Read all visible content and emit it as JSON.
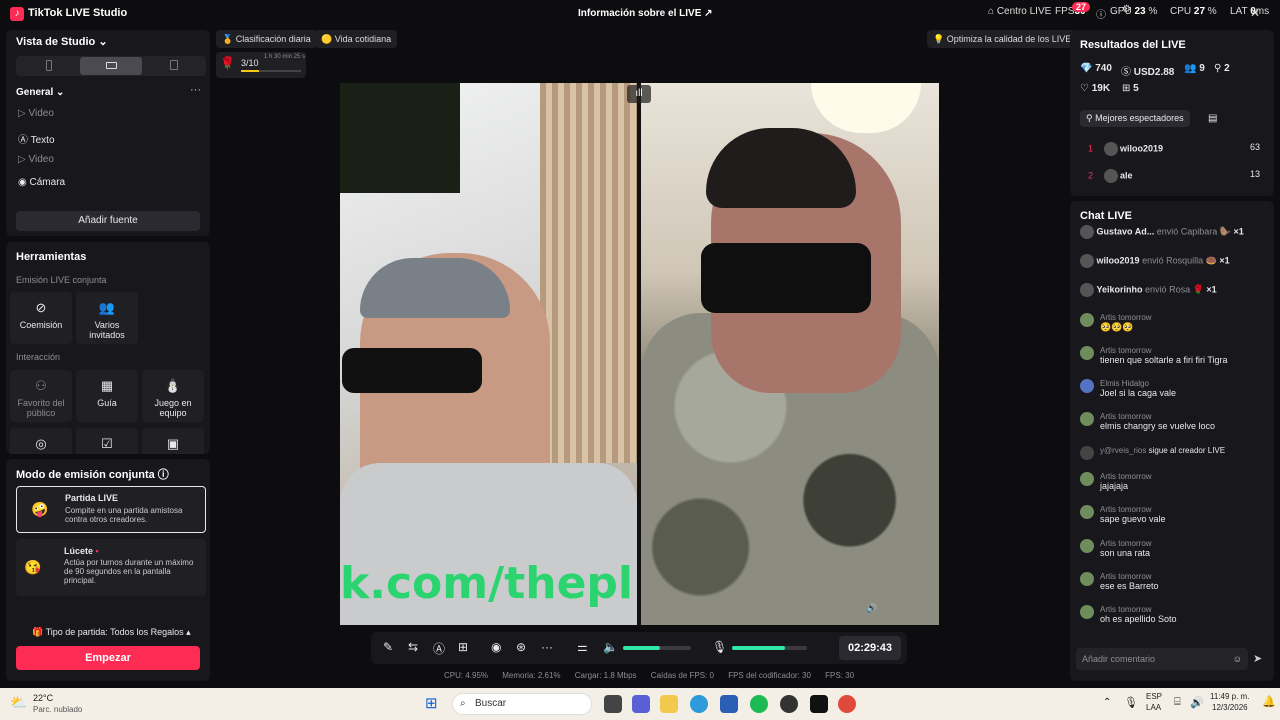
{
  "titlebar": {
    "app_title": "TikTok LIVE Studio",
    "live_info": "Información sobre el LIVE",
    "centro_live": "Centro LIVE",
    "fps_label": "FPS",
    "fps_value": "30",
    "fps_badge": "27",
    "gpu_label": "GPU",
    "gpu_value": "23",
    "cpu_label": "CPU",
    "cpu_value": "27",
    "lat_label": "LAT",
    "lat_value": "0"
  },
  "studio": {
    "view_label": "Vista de Studio",
    "general_label": "General",
    "sources": [
      "Video",
      "Texto",
      "Video",
      "Cámara"
    ],
    "add_source": "Añadir fuente"
  },
  "tools": {
    "title": "Herramientas",
    "joint_label": "Emisión LIVE conjunta",
    "joint_items": [
      "Coemisión",
      "Varios invitados"
    ],
    "interaction_label": "Interacción",
    "interaction_items": [
      "Favorito del público",
      "Guía",
      "Juego en equipo"
    ]
  },
  "joint_mode": {
    "title": "Modo de emisión conjunta",
    "modes": [
      {
        "name": "Partida LIVE",
        "desc": "Compite en una partida amistosa contra otros creadores."
      },
      {
        "name": "Lúcete",
        "desc": "Actúa por turnos durante un máximo de 90 segundos en la pantalla principal."
      }
    ],
    "match_type": "Tipo de partida: Todos los Regalos",
    "start": "Empezar"
  },
  "top_chips": {
    "daily_rank": "Clasificación diaria",
    "daily_life": "Vida cotidiana",
    "optimize": "Optimiza la calidad de los LIVE",
    "match_count": "3/10",
    "match_time": "1 h 30 min 25 s"
  },
  "video": {
    "banner_text": "k.com/thepl"
  },
  "controls": {
    "timer": "02:29:43",
    "volume_fraction": 0.55,
    "mic_fraction": 0.7
  },
  "perf": {
    "cpu": "CPU:  4.95%",
    "memory": "Memoria:  2.61%",
    "load": "Cargar:  1.8 Mbps",
    "fps_drops": "Caídas de FPS:  0",
    "encoder_fps": "FPS del codificador:  30",
    "fps": "FPS:  30"
  },
  "results": {
    "title": "Resultados del LIVE",
    "diamonds": "740",
    "usd": "USD2.88",
    "viewers": "9",
    "new_followers": "2",
    "likes": "19K",
    "gifts": "5",
    "top_viewers_label": "Mejores espectadores",
    "top_viewers": [
      {
        "rank": "1",
        "name": "wiloo2019",
        "score": "63"
      },
      {
        "rank": "2",
        "name": "ale",
        "score": "13"
      }
    ]
  },
  "chat": {
    "title": "Chat LIVE",
    "gifts": [
      {
        "name": "Gustavo Ad...",
        "action": "envió Capibara",
        "count": "×1"
      },
      {
        "name": "wiloo2019",
        "action": "envió Rosquilla",
        "count": "×1"
      },
      {
        "name": "Yeikorinho",
        "action": "envió Rosa",
        "count": "×1"
      }
    ],
    "messages": [
      {
        "name": "Artis tomorrow",
        "text": "🥺🥺🥺"
      },
      {
        "name": "Artis tomorrow",
        "text": "tienen que soltarle a firi firi Tigra"
      },
      {
        "name": "Elmis Hidalgo",
        "text": "Joel si la caga vale"
      },
      {
        "name": "Artis tomorrow",
        "text": "elmis changry se vuelve loco"
      },
      {
        "name": "y@rveis_rios",
        "text": "sigue al creador LIVE"
      },
      {
        "name": "Artis tomorrow",
        "text": "jajajaja"
      },
      {
        "name": "Artis tomorrow",
        "text": "sape guevo vale"
      },
      {
        "name": "Artis tomorrow",
        "text": "son una rata"
      },
      {
        "name": "Artis tomorrow",
        "text": "ese es Barreto"
      },
      {
        "name": "Artis tomorrow",
        "text": "oh es apellido Soto"
      }
    ],
    "input_placeholder": "Añadir comentario"
  },
  "taskbar": {
    "temp": "22°C",
    "weather": "Parc. nublado",
    "search": "Buscar",
    "lang": "ESP",
    "lang2": "LAA",
    "time": "11:49 p. m.",
    "date": "12/3/2026"
  }
}
